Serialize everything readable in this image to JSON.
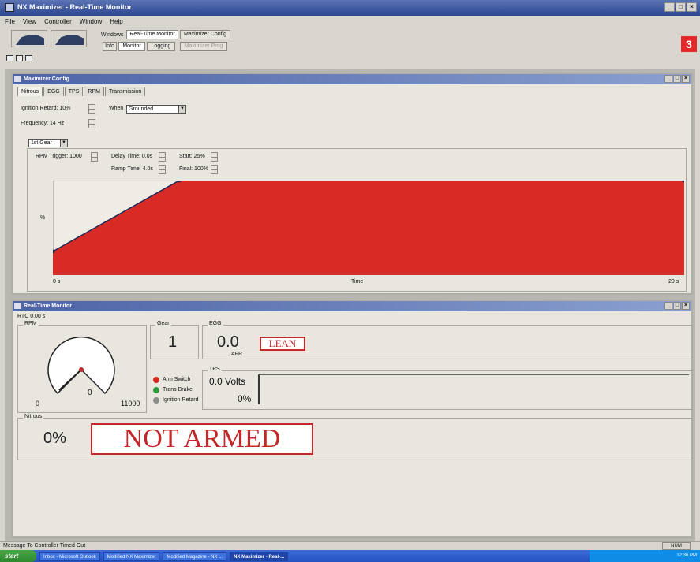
{
  "window": {
    "title": "NX Maximizer - Real-Time Monitor",
    "min": "_",
    "max": "□",
    "close": "×"
  },
  "menu": [
    "File",
    "View",
    "Controller",
    "Window",
    "Help"
  ],
  "toolbar": {
    "btn_windows": "Windows",
    "btn_realtime": "Real-Time Monitor",
    "btn_config": "Maximizer Config",
    "btn_info": "Info",
    "btn_monitor": "Monitor",
    "btn_logging": "Logging",
    "btn_disabled": "Maximizer Prog"
  },
  "badge": "3",
  "config_window": {
    "title": "Maximizer Config",
    "tabs": [
      "Nitrous",
      "EGG",
      "TPS",
      "RPM",
      "Transmission"
    ],
    "ignition_retard": "Ignition Retard: 10%",
    "when_label": "When",
    "when_value": "Grounded",
    "frequency": "Frequency: 14 Hz",
    "gear_value": "1st Gear",
    "rpm_trigger": "RPM Trigger: 1000",
    "delay_time": "Delay Time: 0.0s",
    "ramp_time": "Ramp Time: 4.0s",
    "start": "Start: 25%",
    "final": "Final: 100%",
    "chart_ylabel": "%",
    "chart_x_start": "0 s",
    "chart_xlabel": "Time",
    "chart_x_end": "20 s"
  },
  "chart_data": {
    "type": "area",
    "x": [
      0,
      4,
      20
    ],
    "values": [
      25,
      100,
      100
    ],
    "xlim": [
      0,
      20
    ],
    "ylim": [
      0,
      100
    ],
    "xlabel": "Time",
    "ylabel": "%",
    "color": "#d92b26"
  },
  "monitor_window": {
    "title": "Real-Time Monitor",
    "rtc": "RTC 0.00 s",
    "rpm_label": "RPM",
    "rpm_value": "0",
    "rpm_min": "0",
    "rpm_max": "11000",
    "gear_label": "Gear",
    "gear_value": "1",
    "egg_label": "EGG",
    "egg_value": "0.0",
    "egg_unit": "AFR",
    "lean_label": "LEAN",
    "switches": [
      {
        "label": "Arm Switch",
        "color": "#d42a22"
      },
      {
        "label": "Trans Brake",
        "color": "#2e9a3c"
      },
      {
        "label": "Ignition Retard",
        "color": "#8c8c8c"
      }
    ],
    "tps_label": "TPS",
    "tps_volts": "0.0 Volts",
    "tps_percent": "0%",
    "nitrous_label": "Nitrous",
    "nitrous_value": "0%",
    "armed_status": "NOT ARMED"
  },
  "status": {
    "message": "Message To Controller Timed Out",
    "num": "NUM"
  },
  "taskbar": {
    "start": "start",
    "tasks": [
      "Inbox - Microsoft Outlook",
      "Modified NX Maximizer",
      "Modified Magazine - NX ...",
      "NX Maximizer - Real-..."
    ],
    "clock": "12:36 PM"
  }
}
